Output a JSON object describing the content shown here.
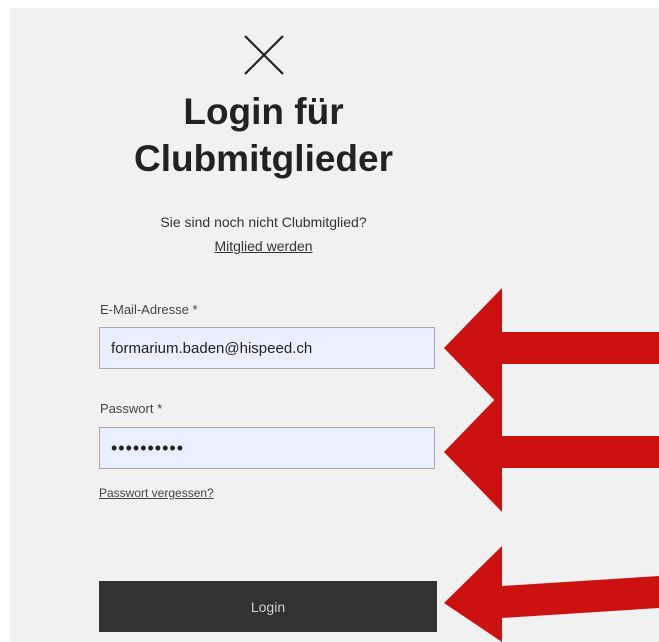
{
  "login": {
    "title_line1": "Login für",
    "title_line2": "Clubmitglieder",
    "subtitle": "Sie sind noch nicht Clubmitglied?",
    "signup_link": "Mitglied werden",
    "email_label": "E-Mail-Adresse *",
    "email_value": "formarium.baden@hispeed.ch",
    "password_label": "Passwort *",
    "password_value": "••••••••••",
    "forgot_link": "Passwort vergessen?",
    "login_button": "Login"
  },
  "colors": {
    "arrow": "#cc1111",
    "button_bg": "#323232",
    "input_bg": "#e9efff",
    "panel_bg": "#f1f1f1"
  },
  "icons": {
    "close": "close-icon",
    "annotation": "arrow-left-icon"
  }
}
